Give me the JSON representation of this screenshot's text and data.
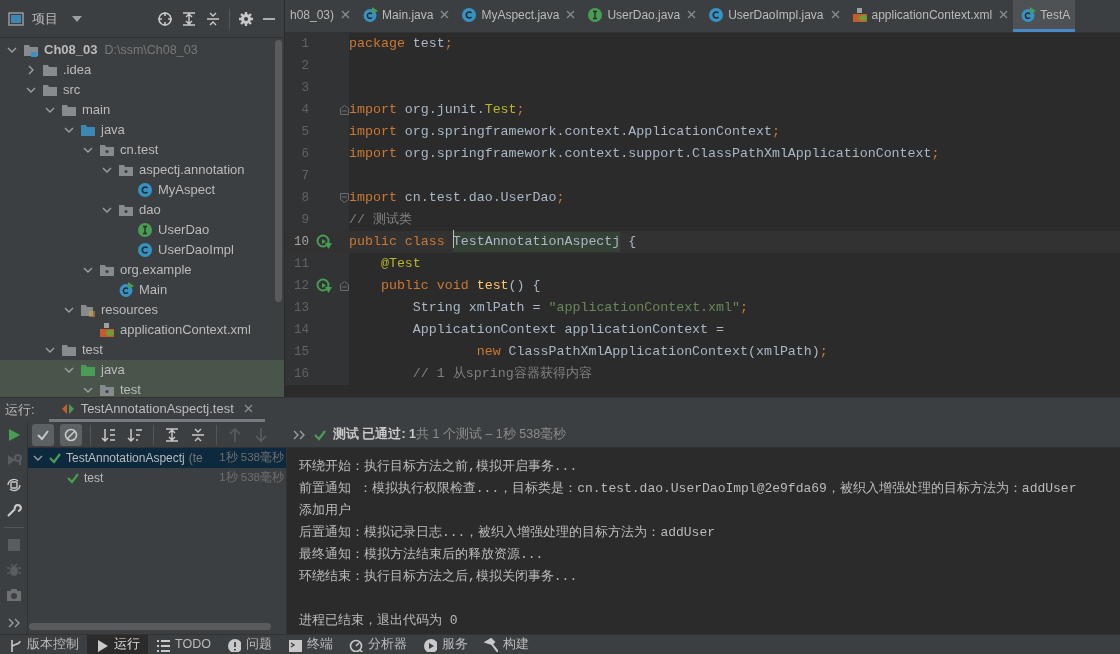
{
  "project_panel": {
    "title": "项目",
    "tree": [
      {
        "label": "Ch08_03",
        "hint": "D:\\ssm\\Ch08_03",
        "kind": "module",
        "expanded": true,
        "children": [
          {
            "label": ".idea",
            "kind": "folder",
            "expanded": false
          },
          {
            "label": "src",
            "kind": "folder",
            "expanded": true,
            "children": [
              {
                "label": "main",
                "kind": "folder",
                "expanded": true,
                "children": [
                  {
                    "label": "java",
                    "kind": "source",
                    "expanded": true,
                    "children": [
                      {
                        "label": "cn.test",
                        "kind": "package",
                        "expanded": true,
                        "children": [
                          {
                            "label": "aspectj.annotation",
                            "kind": "package",
                            "expanded": true,
                            "children": [
                              {
                                "label": "MyAspect",
                                "kind": "class"
                              }
                            ]
                          },
                          {
                            "label": "dao",
                            "kind": "package",
                            "expanded": true,
                            "children": [
                              {
                                "label": "UserDao",
                                "kind": "interface"
                              },
                              {
                                "label": "UserDaoImpl",
                                "kind": "class"
                              }
                            ]
                          }
                        ]
                      },
                      {
                        "label": "org.example",
                        "kind": "package",
                        "expanded": true,
                        "children": [
                          {
                            "label": "Main",
                            "kind": "runnable"
                          }
                        ]
                      }
                    ]
                  },
                  {
                    "label": "resources",
                    "kind": "resources",
                    "expanded": true,
                    "children": [
                      {
                        "label": "applicationContext.xml",
                        "kind": "xml"
                      }
                    ]
                  }
                ]
              },
              {
                "label": "test",
                "kind": "folder",
                "expanded": true,
                "children": [
                  {
                    "label": "java",
                    "kind": "tests",
                    "expanded": true,
                    "test_scope": true,
                    "children": [
                      {
                        "label": "test",
                        "kind": "package",
                        "expanded": true,
                        "test_scope": true
                      }
                    ]
                  }
                ]
              }
            ]
          }
        ]
      }
    ]
  },
  "editor": {
    "tabs": [
      {
        "label": "h08_03)",
        "kind": "plain",
        "selected": false
      },
      {
        "label": "Main.java",
        "kind": "runnable",
        "selected": false
      },
      {
        "label": "MyAspect.java",
        "kind": "class",
        "selected": false
      },
      {
        "label": "UserDao.java",
        "kind": "interface",
        "selected": false
      },
      {
        "label": "UserDaoImpl.java",
        "kind": "class",
        "selected": false
      },
      {
        "label": "applicationContext.xml",
        "kind": "xml",
        "selected": false
      },
      {
        "label": "TestA",
        "kind": "runnable",
        "selected": true
      }
    ],
    "lines": [
      {
        "number": "1",
        "segments": [
          {
            "kind": "keyword",
            "text": "package "
          },
          {
            "kind": "plain",
            "text": "test"
          },
          {
            "kind": "keyword",
            "text": ";"
          }
        ]
      },
      {
        "number": "2"
      },
      {
        "number": "3"
      },
      {
        "number": "4",
        "fold_start": true,
        "segments": [
          {
            "kind": "keyword",
            "text": "import "
          },
          {
            "kind": "plain",
            "text": "org.junit."
          },
          {
            "kind": "annotation",
            "text": "Test"
          },
          {
            "kind": "keyword",
            "text": ";"
          }
        ]
      },
      {
        "number": "5",
        "segments": [
          {
            "kind": "keyword",
            "text": "import "
          },
          {
            "kind": "plain",
            "text": "org.springframework.context.ApplicationContext"
          },
          {
            "kind": "keyword",
            "text": ";"
          }
        ]
      },
      {
        "number": "6",
        "segments": [
          {
            "kind": "keyword",
            "text": "import "
          },
          {
            "kind": "plain",
            "text": "org.springframework.context.support.ClassPathXmlApplicationContext"
          },
          {
            "kind": "keyword",
            "text": ";"
          }
        ]
      },
      {
        "number": "7"
      },
      {
        "number": "8",
        "fold_end": true,
        "segments": [
          {
            "kind": "keyword",
            "text": "import "
          },
          {
            "kind": "plain",
            "text": "cn.test.dao.UserDao"
          },
          {
            "kind": "keyword",
            "text": ";"
          }
        ]
      },
      {
        "number": "9",
        "segments": [
          {
            "kind": "comment",
            "text": "// 测试类"
          }
        ]
      },
      {
        "number": "10",
        "current": true,
        "runnable": true,
        "segments": [
          {
            "kind": "keyword",
            "text": "public class "
          },
          {
            "kind": "highlight",
            "text": "TestAnnotationAspectj"
          },
          {
            "kind": "plain",
            "text": " {"
          }
        ]
      },
      {
        "number": "11",
        "segments": [
          {
            "kind": "annotation",
            "text": "    @Test"
          }
        ]
      },
      {
        "number": "12",
        "runnable": true,
        "fold_start": true,
        "segments": [
          {
            "kind": "keyword",
            "text": "    public void "
          },
          {
            "kind": "method",
            "text": "test"
          },
          {
            "kind": "plain",
            "text": "() {"
          }
        ]
      },
      {
        "number": "13",
        "segments": [
          {
            "kind": "plain",
            "text": "        String xmlPath = "
          },
          {
            "kind": "string",
            "text": "\"applicationContext.xml\""
          },
          {
            "kind": "keyword",
            "text": ";"
          }
        ]
      },
      {
        "number": "14",
        "segments": [
          {
            "kind": "plain",
            "text": "        ApplicationContext applicationContext ="
          }
        ]
      },
      {
        "number": "15",
        "segments": [
          {
            "kind": "keyword",
            "text": "                new "
          },
          {
            "kind": "plain",
            "text": "ClassPathXmlApplicationContext(xmlPath)"
          },
          {
            "kind": "keyword",
            "text": ";"
          }
        ]
      },
      {
        "number": "16",
        "segments": [
          {
            "kind": "comment",
            "text": "        // 1 从spring容器获得内容"
          }
        ]
      }
    ]
  },
  "run_panel": {
    "label": "运行:",
    "tab": "TestAnnotationAspectj.test",
    "status": "**测试 已通过: 1**共 1 个测试 – 1秒 538毫秒",
    "tests": [
      {
        "label": "TestAnnotationAspectj",
        "hint": "(te",
        "time": "1秒 538毫秒",
        "passed": true,
        "expanded": true,
        "selected": true,
        "children": [
          {
            "label": "test",
            "time": "1秒 538毫秒",
            "passed": true,
            "selected": false
          }
        ]
      }
    ],
    "console": [
      "环绕开始：执行目标方法之前,模拟开启事务...",
      "前置通知 ：模拟执行权限检查...，目标类是：cn.test.dao.UserDaoImpl@2e9fda69，被织入增强处理的目标方法为：addUser",
      "添加用户",
      "后置通知：模拟记录日志...，被织入增强处理的目标方法为：addUser",
      "最终通知：模拟方法结束后的释放资源...",
      "环绕结束：执行目标方法之后,模拟关闭事务..."
    ],
    "exit_message": "进程已结束，退出代码为 0"
  },
  "bottom_bar": [
    {
      "label": "版本控制",
      "kind": "branch",
      "selected": false
    },
    {
      "label": "运行",
      "kind": "play",
      "selected": true
    },
    {
      "label": "TODO",
      "kind": "list",
      "selected": false
    },
    {
      "label": "问题",
      "kind": "alert",
      "selected": false
    },
    {
      "label": "终端",
      "kind": "terminal",
      "selected": false
    },
    {
      "label": "分析器",
      "kind": "profiler",
      "selected": false
    },
    {
      "label": "服务",
      "kind": "services",
      "selected": false
    },
    {
      "label": "构建",
      "kind": "hammer",
      "selected": false
    }
  ]
}
